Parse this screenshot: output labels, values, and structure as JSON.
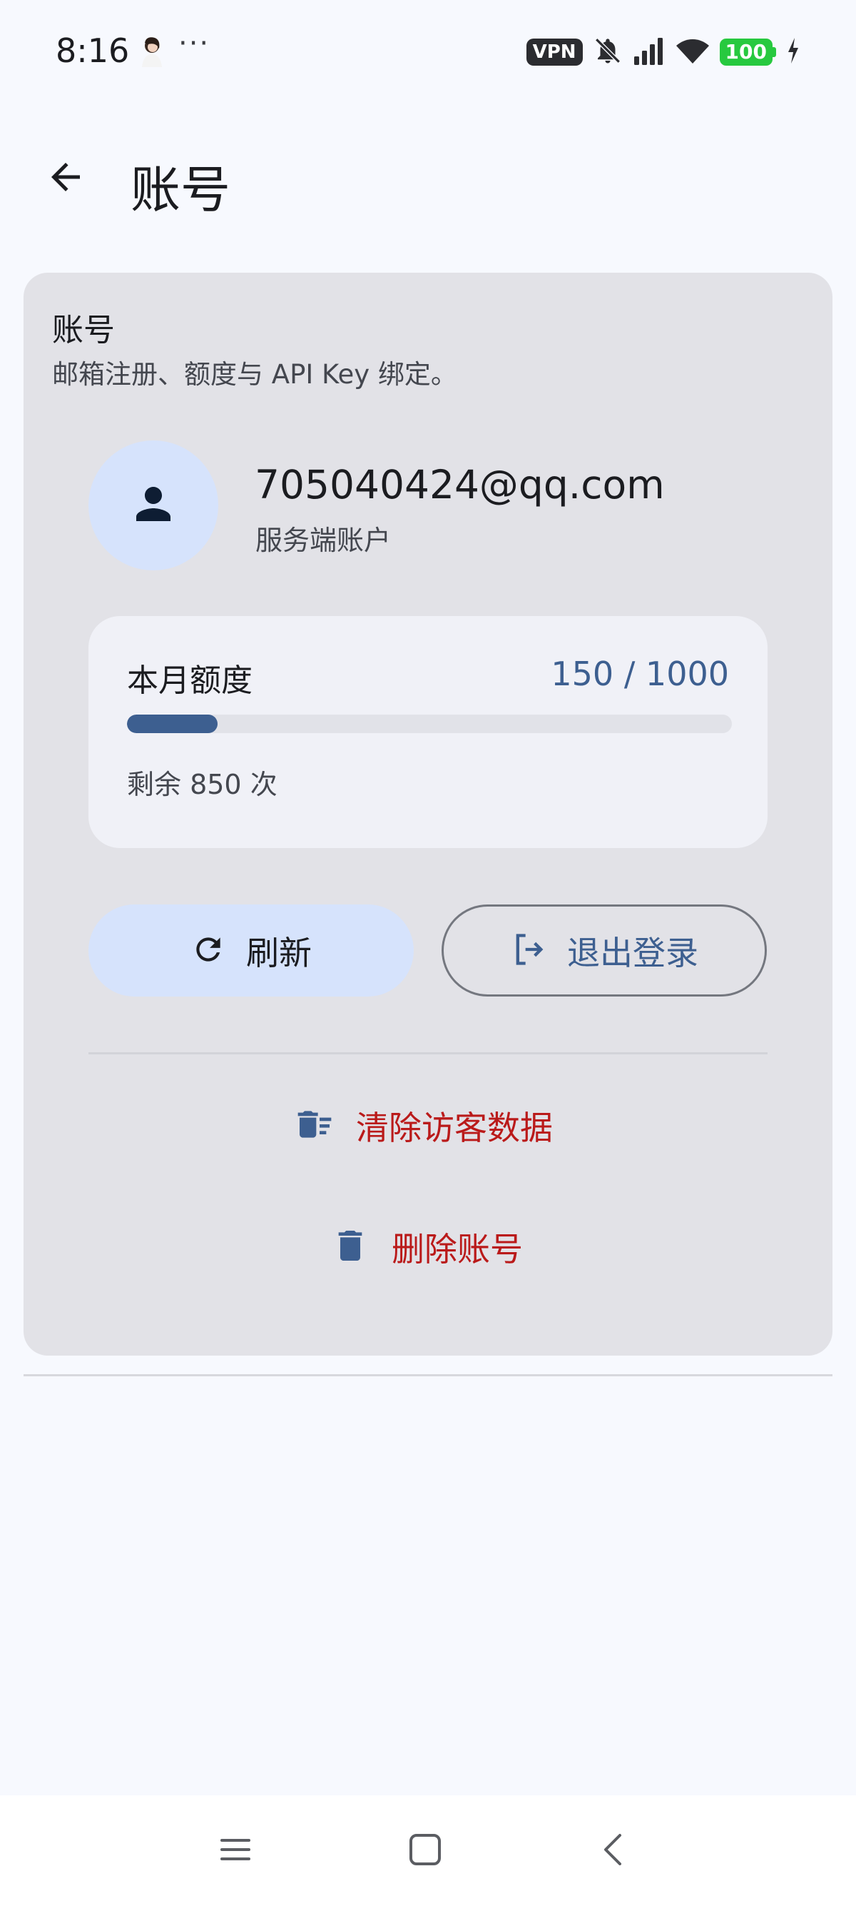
{
  "status_bar": {
    "time": "8:16",
    "more": "···",
    "vpn": "VPN",
    "battery": "100"
  },
  "app_bar": {
    "title": "账号"
  },
  "card": {
    "title": "账号",
    "description": "邮箱注册、额度与 API Key 绑定。",
    "user": {
      "email": "705040424@qq.com",
      "type": "服务端账户"
    },
    "quota": {
      "label": "本月额度",
      "used": 150,
      "total": 1000,
      "value_text": "150 / 1000",
      "remaining_text": "剩余 850 次",
      "fraction": 0.15
    },
    "refresh_label": "刷新",
    "logout_label": "退出登录",
    "clear_guest_label": "清除访客数据",
    "delete_account_label": "删除账号"
  },
  "colors": {
    "primary": "#3d5f90",
    "primary_container": "#d6e3fc",
    "danger": "#ba1a1a",
    "card_bg": "#e2e2e7"
  },
  "icons": {
    "back": "arrow-back-icon",
    "avatar": "person-icon",
    "refresh": "refresh-icon",
    "logout": "logout-icon",
    "clear_guest": "delete-sweep-icon",
    "delete_account": "trash-icon"
  }
}
